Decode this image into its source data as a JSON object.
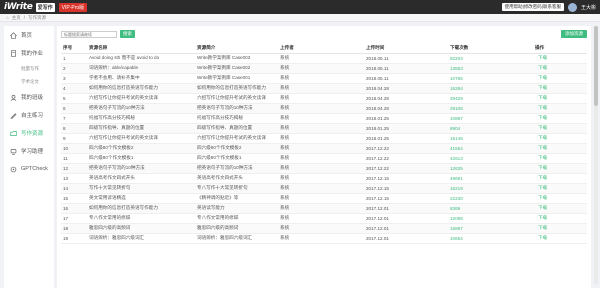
{
  "header": {
    "logo": "iWrite",
    "logo_sub": "爱写作",
    "vip": "VIP-Pro版",
    "btn1": "使用帮助",
    "btn2": "修改密码",
    "btn3": "联系客服",
    "user": "王大彬"
  },
  "breadcrumb": {
    "home": "主页",
    "sep": "/",
    "current": "写作资源"
  },
  "sidebar": {
    "items": [
      {
        "label": "首页",
        "icon": "home-icon"
      },
      {
        "label": "我的作业",
        "icon": "book-icon"
      },
      {
        "label": "批量写作",
        "sub": true
      },
      {
        "label": "学术论文",
        "sub": true
      },
      {
        "label": "我的班级",
        "icon": "class-icon"
      },
      {
        "label": "自主练习",
        "icon": "practice-icon"
      },
      {
        "label": "写作资源",
        "icon": "resource-icon",
        "active": true
      },
      {
        "label": "学习助理",
        "icon": "assistant-icon"
      },
      {
        "label": "GPTCheck",
        "icon": "gpt-icon"
      }
    ]
  },
  "toolbar": {
    "search_placeholder": "标题搜索请继续",
    "search_label": "搜索",
    "add_label": "添加资源"
  },
  "table": {
    "headers": [
      "序号",
      "资源名称",
      "资源简介",
      "上传者",
      "上传时间",
      "下载次数",
      "操作"
    ],
    "rows": [
      [
        "1",
        "Avoid doing sth 而不是 avoid to do",
        "Write教学案例库 Case003",
        "系统",
        "2018.05.11",
        "52204",
        "下载"
      ],
      [
        "2",
        "词语辨析：able/capable",
        "Write教学案例库 Case002",
        "系统",
        "2018.05.11",
        "13553",
        "下载"
      ],
      [
        "3",
        "学者不会用、请补齐集中",
        "Write教学案例库 Case001",
        "系统",
        "2018.05.11",
        "10766",
        "下载"
      ],
      [
        "4",
        "如何用你的信息打造英语写作能力",
        "如何用你的信息打造英语写作能力",
        "系统",
        "2018.04.28",
        "16284",
        "下载"
      ],
      [
        "5",
        "六招写作让你提升考试的英文读译",
        "六招写作让你提升考试的英文读译",
        "系统",
        "2018.04.28",
        "29429",
        "下载"
      ],
      [
        "6",
        "把英语句子写流的10种方法",
        "把英语句子写流的10种方法",
        "系统",
        "2018.04.28",
        "29108",
        "下载"
      ],
      [
        "7",
        "托福写作高分技巧揭秘",
        "托福写作高分技巧揭秘",
        "系统",
        "2018.01.25",
        "10887",
        "下载"
      ],
      [
        "8",
        "四级写作指导、真题的位置",
        "四级写作指导、真题的位置",
        "系统",
        "2018.01.25",
        "8904",
        "下载"
      ],
      [
        "9",
        "六招写作让你提升考试的英文读译",
        "六招写作让你提升考试的英文读译",
        "系统",
        "2018.01.25",
        "16145",
        "下载"
      ],
      [
        "10",
        "四六级80个作文模板2",
        "四六级80个作文模板2",
        "系统",
        "2017.12.22",
        "41554",
        "下载"
      ],
      [
        "11",
        "四六级80个作文模板1",
        "四六级80个作文模板1",
        "系统",
        "2017.12.22",
        "42613",
        "下载"
      ],
      [
        "12",
        "把英语句子写流的10种方法",
        "把英语句子写流的10种方法",
        "系统",
        "2017.12.22",
        "12635",
        "下载"
      ],
      [
        "13",
        "英语高考作文四式开头",
        "英语高考作文四式开头",
        "系统",
        "2017.12.15",
        "49691",
        "下载"
      ],
      [
        "14",
        "写作十大常见转折句",
        "专八写作十大常见转折句",
        "系统",
        "2017.12.15",
        "16219",
        "下载"
      ],
      [
        "15",
        "英文常用谚语精选",
        "《精神调的贴近》等",
        "系统",
        "2017.12.15",
        "22230",
        "下载"
      ],
      [
        "16",
        "如何用你的信息打造英语写作能力",
        "英语读写能力",
        "系统",
        "2017.12.01",
        "8369",
        "下载"
      ],
      [
        "17",
        "专八作文常用的修辞",
        "专八作文常用的修辞",
        "系统",
        "2017.12.01",
        "12058",
        "下载"
      ],
      [
        "18",
        "雅思四六级的高频词",
        "雅思四六级的高频词",
        "系统",
        "2017.12.01",
        "15897",
        "下载"
      ],
      [
        "19",
        "词语辨析：雅思四六级词汇",
        "词语辨析：雅思四六级词汇",
        "系统",
        "2017.12.01",
        "10654",
        "下载"
      ]
    ]
  },
  "colors": {
    "accent": "#3fbc7f",
    "topbar": "#2b2b2b",
    "vip": "#d9342b"
  }
}
